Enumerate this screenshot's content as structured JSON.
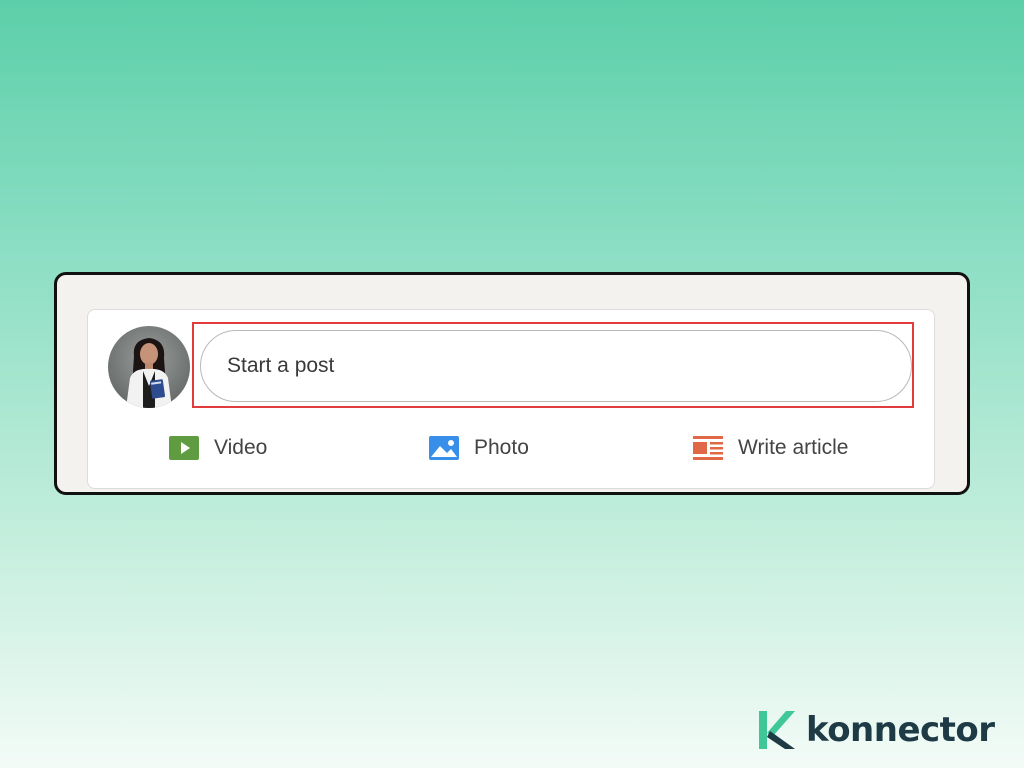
{
  "composer": {
    "placeholder": "Start a post",
    "actions": [
      {
        "label": "Video",
        "icon": "video-icon",
        "color": "#5f9b41"
      },
      {
        "label": "Photo",
        "icon": "photo-icon",
        "color": "#378fe9"
      },
      {
        "label": "Write article",
        "icon": "article-icon",
        "color": "#e06847"
      }
    ]
  },
  "brand": {
    "name": "konnector",
    "accent": "#3fc79a",
    "text_color": "#1d3a45"
  },
  "colors": {
    "highlight": "#e23b3b",
    "frame_bg": "#f3f2ef"
  }
}
